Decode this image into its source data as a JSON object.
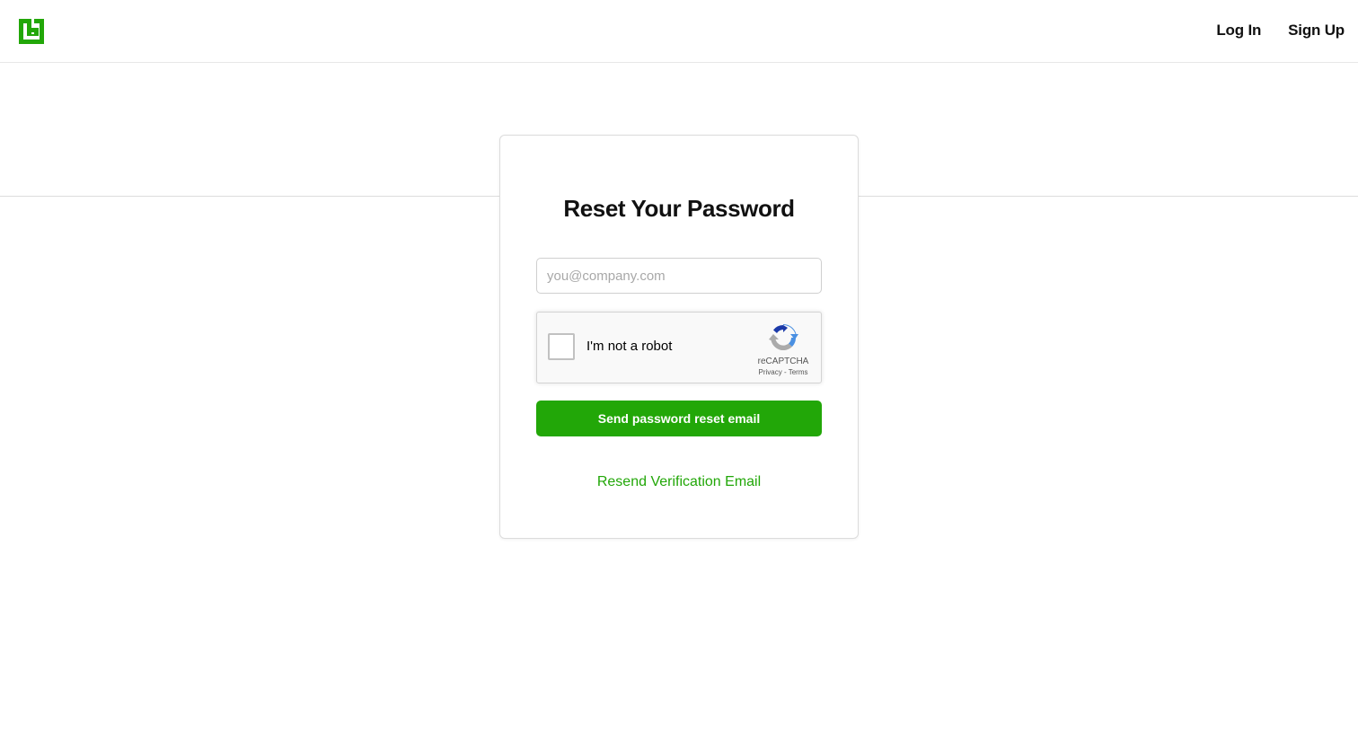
{
  "header": {
    "logo_icon": "brand-logo-icon",
    "brand_color": "#22a708",
    "nav": {
      "login_label": "Log In",
      "signup_label": "Sign Up"
    }
  },
  "card": {
    "title": "Reset Your Password",
    "email": {
      "value": "",
      "placeholder": "you@company.com"
    },
    "recaptcha": {
      "checkbox_label": "I'm not a robot",
      "brand": "reCAPTCHA",
      "privacy_label": "Privacy",
      "separator": " - ",
      "terms_label": "Terms",
      "logo_icon": "recaptcha-logo-icon"
    },
    "submit_label": "Send password reset email",
    "resend_label": "Resend Verification Email"
  },
  "colors": {
    "accent": "#22a708",
    "text": "#111111",
    "placeholder": "#a8a8a8",
    "border": "#dcdcdc"
  }
}
